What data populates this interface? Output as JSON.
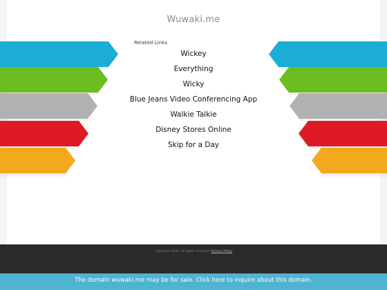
{
  "site": {
    "title": "Wuwaki.me"
  },
  "related": {
    "label": "Related Links",
    "links": [
      "Wickey",
      "Everything",
      "Wicky",
      "Blue Jeans Video Conferencing App",
      "Walkie Talkie",
      "Disney Stores Online",
      "Skip for a Day"
    ]
  },
  "ribbons": {
    "colors": [
      "#1bacd8",
      "#6cbd1f",
      "#b1b1b1",
      "#de1a24",
      "#f3a91d"
    ],
    "icons": [
      "arrow-ribbon-right",
      "arrow-ribbon-left"
    ]
  },
  "footer": {
    "copyright": "Copyright 2020. All rights reserved.",
    "privacy_label": "Privacy Policy"
  },
  "banner": {
    "text": "The domain wuwaki.me may be for sale. Click here to inquire about this domain."
  }
}
